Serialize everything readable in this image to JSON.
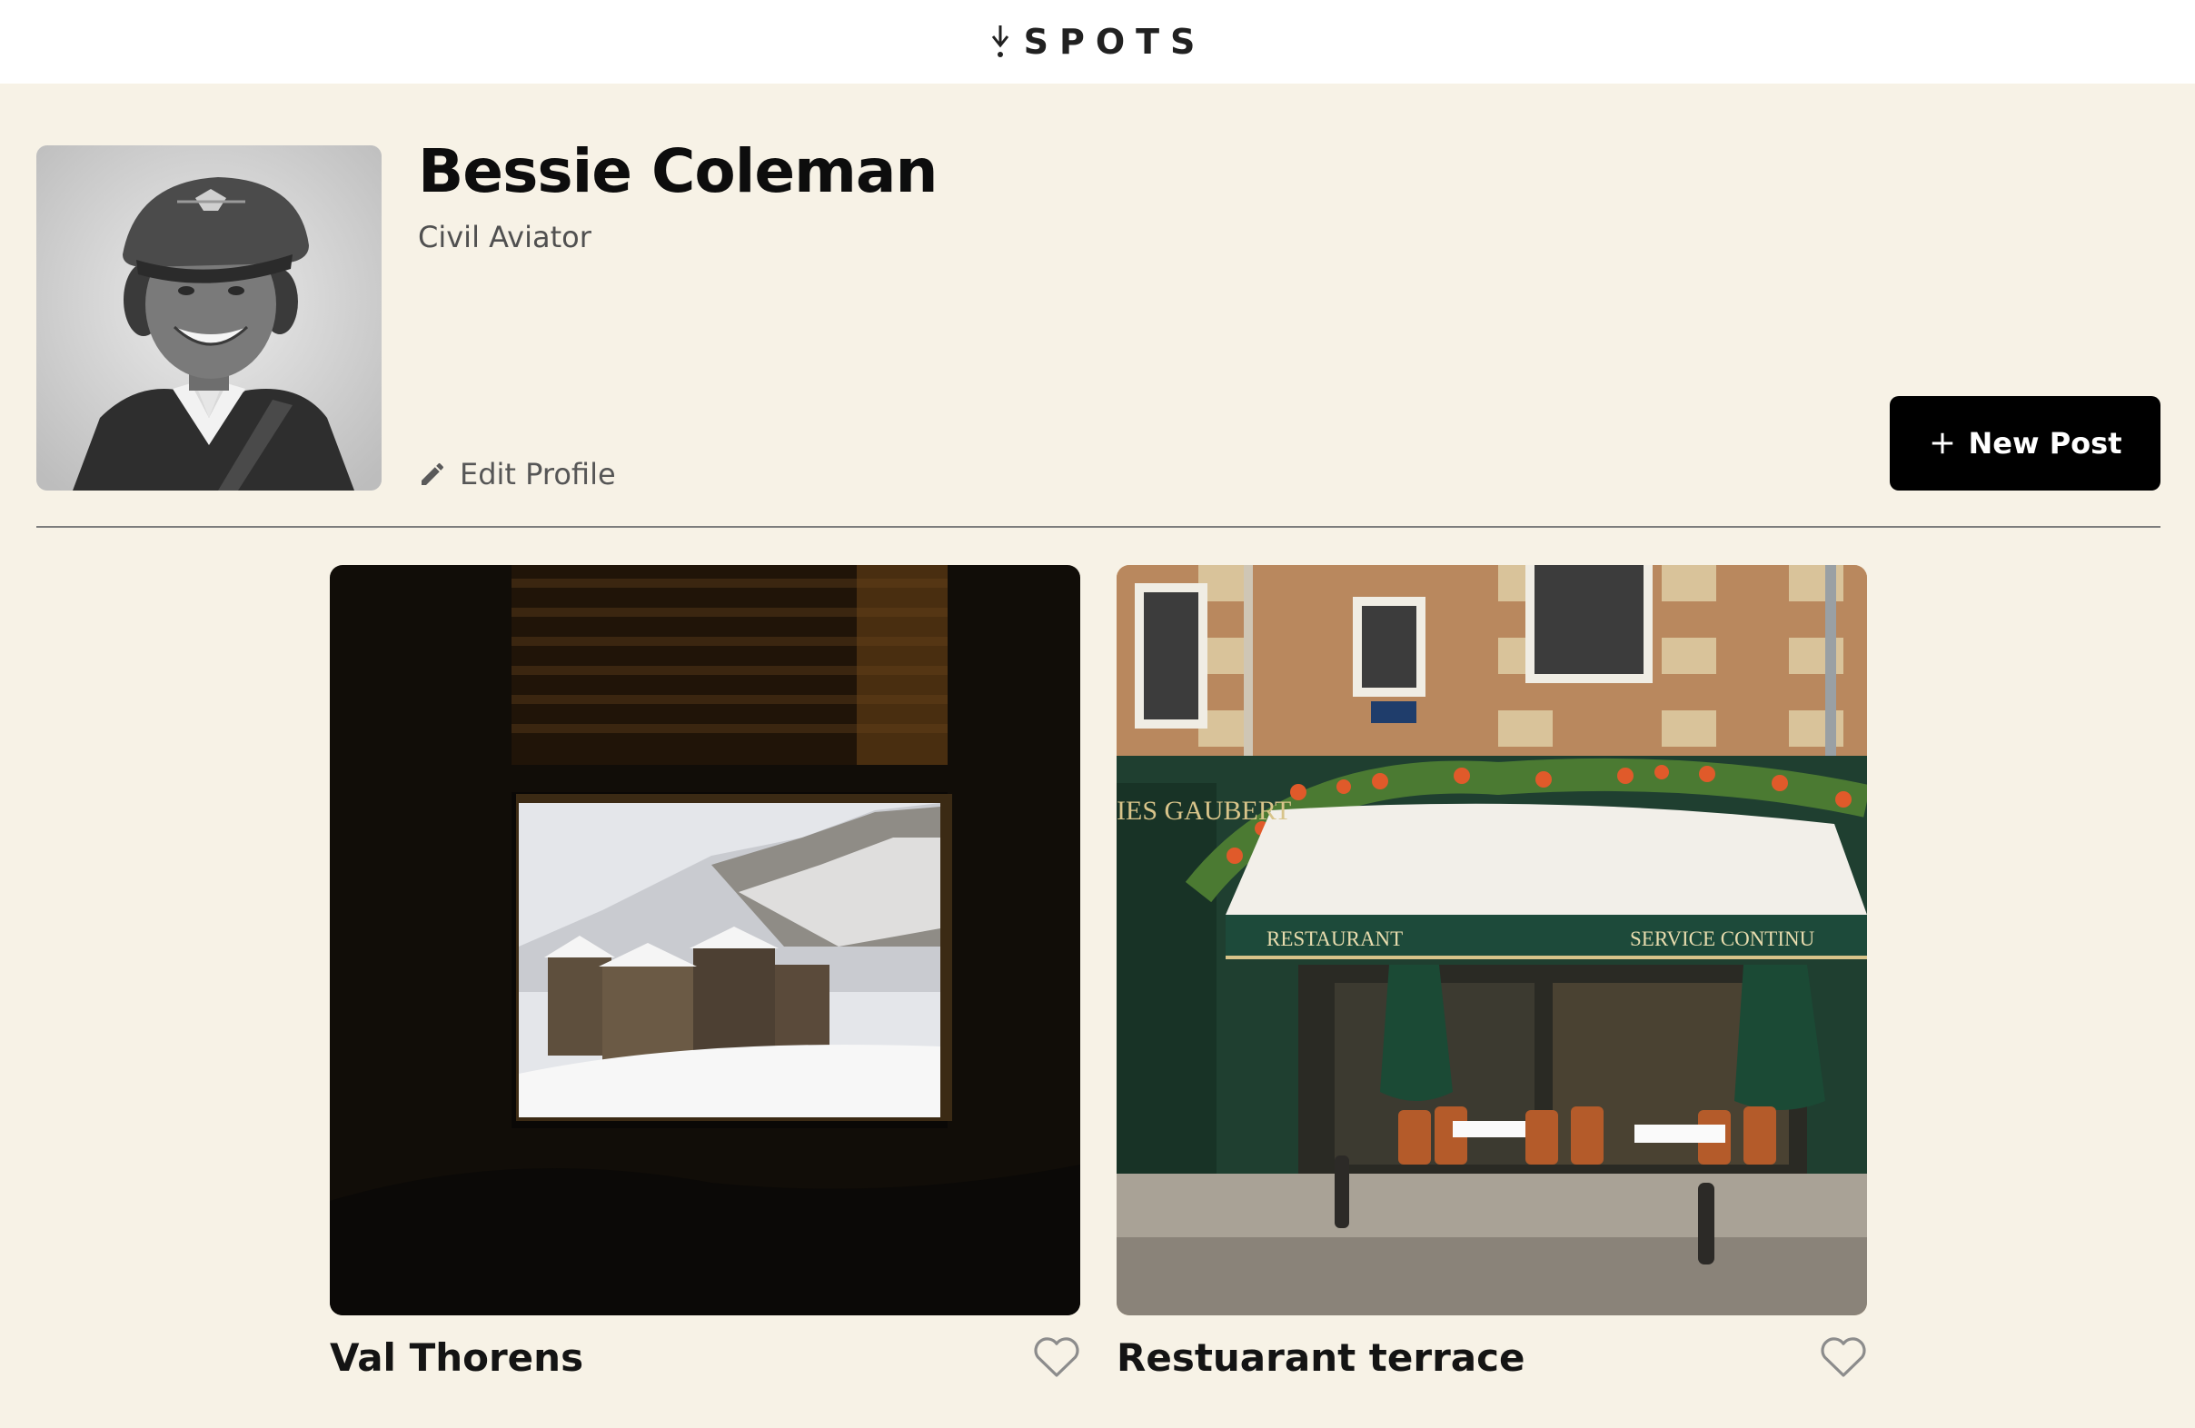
{
  "header": {
    "logo_text": "SPOTS",
    "logo_icon": "down-arrow-stem-icon"
  },
  "profile": {
    "name": "Bessie Coleman",
    "title": "Civil Aviator",
    "avatar_icon": "avatar-photo",
    "edit_label": "Edit Profile",
    "edit_icon": "pencil-icon"
  },
  "actions": {
    "new_post_label": "New Post",
    "new_post_icon": "plus-icon"
  },
  "cards": [
    {
      "title": "Val Thorens",
      "image": "snowy-village-through-window",
      "liked": false,
      "like_icon": "heart-outline-icon"
    },
    {
      "title": "Restuarant terrace",
      "image": "paris-restaurant-storefront",
      "liked": false,
      "like_icon": "heart-outline-icon"
    }
  ],
  "colors": {
    "page_bg": "#f7f2e6",
    "header_bg": "#ffffff",
    "button_bg": "#000000",
    "divider": "#7d7d7d",
    "muted_text": "#565656"
  }
}
